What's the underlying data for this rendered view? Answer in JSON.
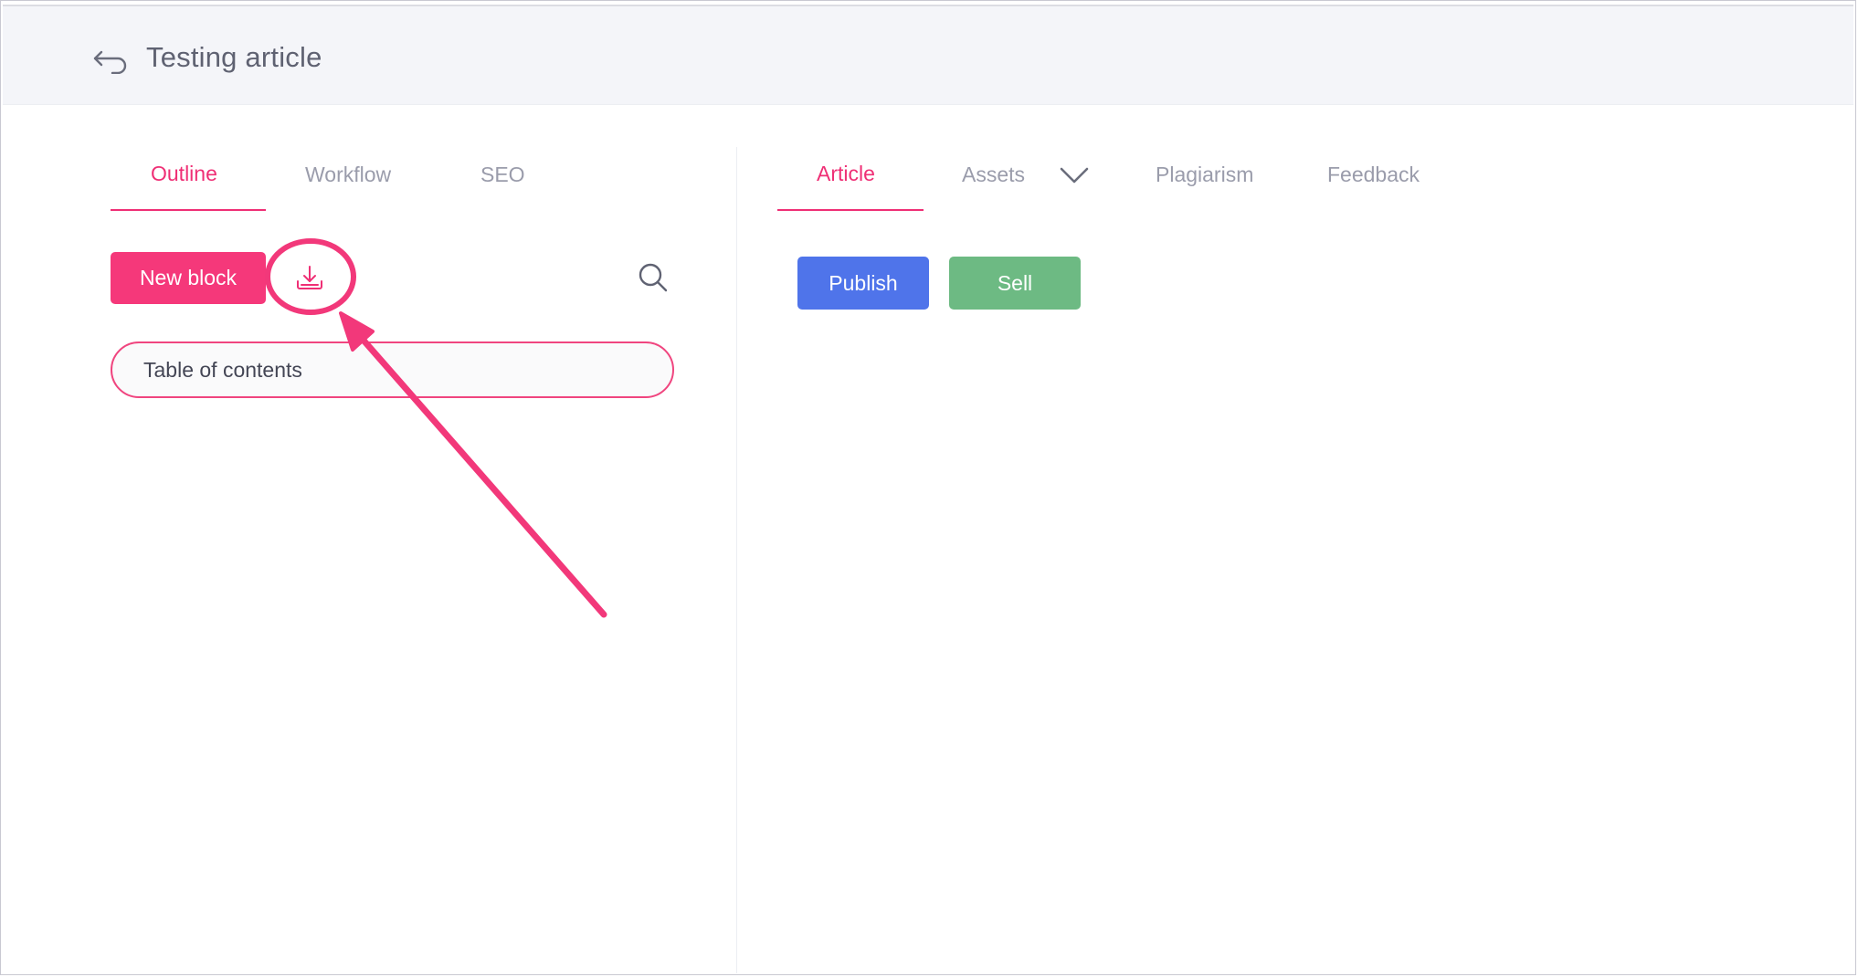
{
  "header": {
    "title": "Testing article",
    "back_icon": "back-arrow-icon"
  },
  "left_panel": {
    "tabs": [
      {
        "label": "Outline",
        "active": true
      },
      {
        "label": "Workflow",
        "active": false
      },
      {
        "label": "SEO",
        "active": false
      }
    ],
    "new_block_label": "New block",
    "download_icon": "download-icon",
    "search_icon": "search-icon",
    "toc_label": "Table of contents"
  },
  "right_panel": {
    "tabs": [
      {
        "label": "Article",
        "active": true
      },
      {
        "label": "Assets",
        "active": false,
        "has_dropdown": true
      },
      {
        "label": "Plagiarism",
        "active": false
      },
      {
        "label": "Feedback",
        "active": false
      }
    ],
    "publish_label": "Publish",
    "sell_label": "Sell"
  },
  "colors": {
    "accent": "#ef2f75",
    "publish": "#4f74ea",
    "sell": "#6dba83",
    "header_bg": "#f4f5f9",
    "inactive_tab": "#9a9cab"
  },
  "annotation": {
    "type": "arrow-and-circle",
    "target": "download-icon"
  }
}
